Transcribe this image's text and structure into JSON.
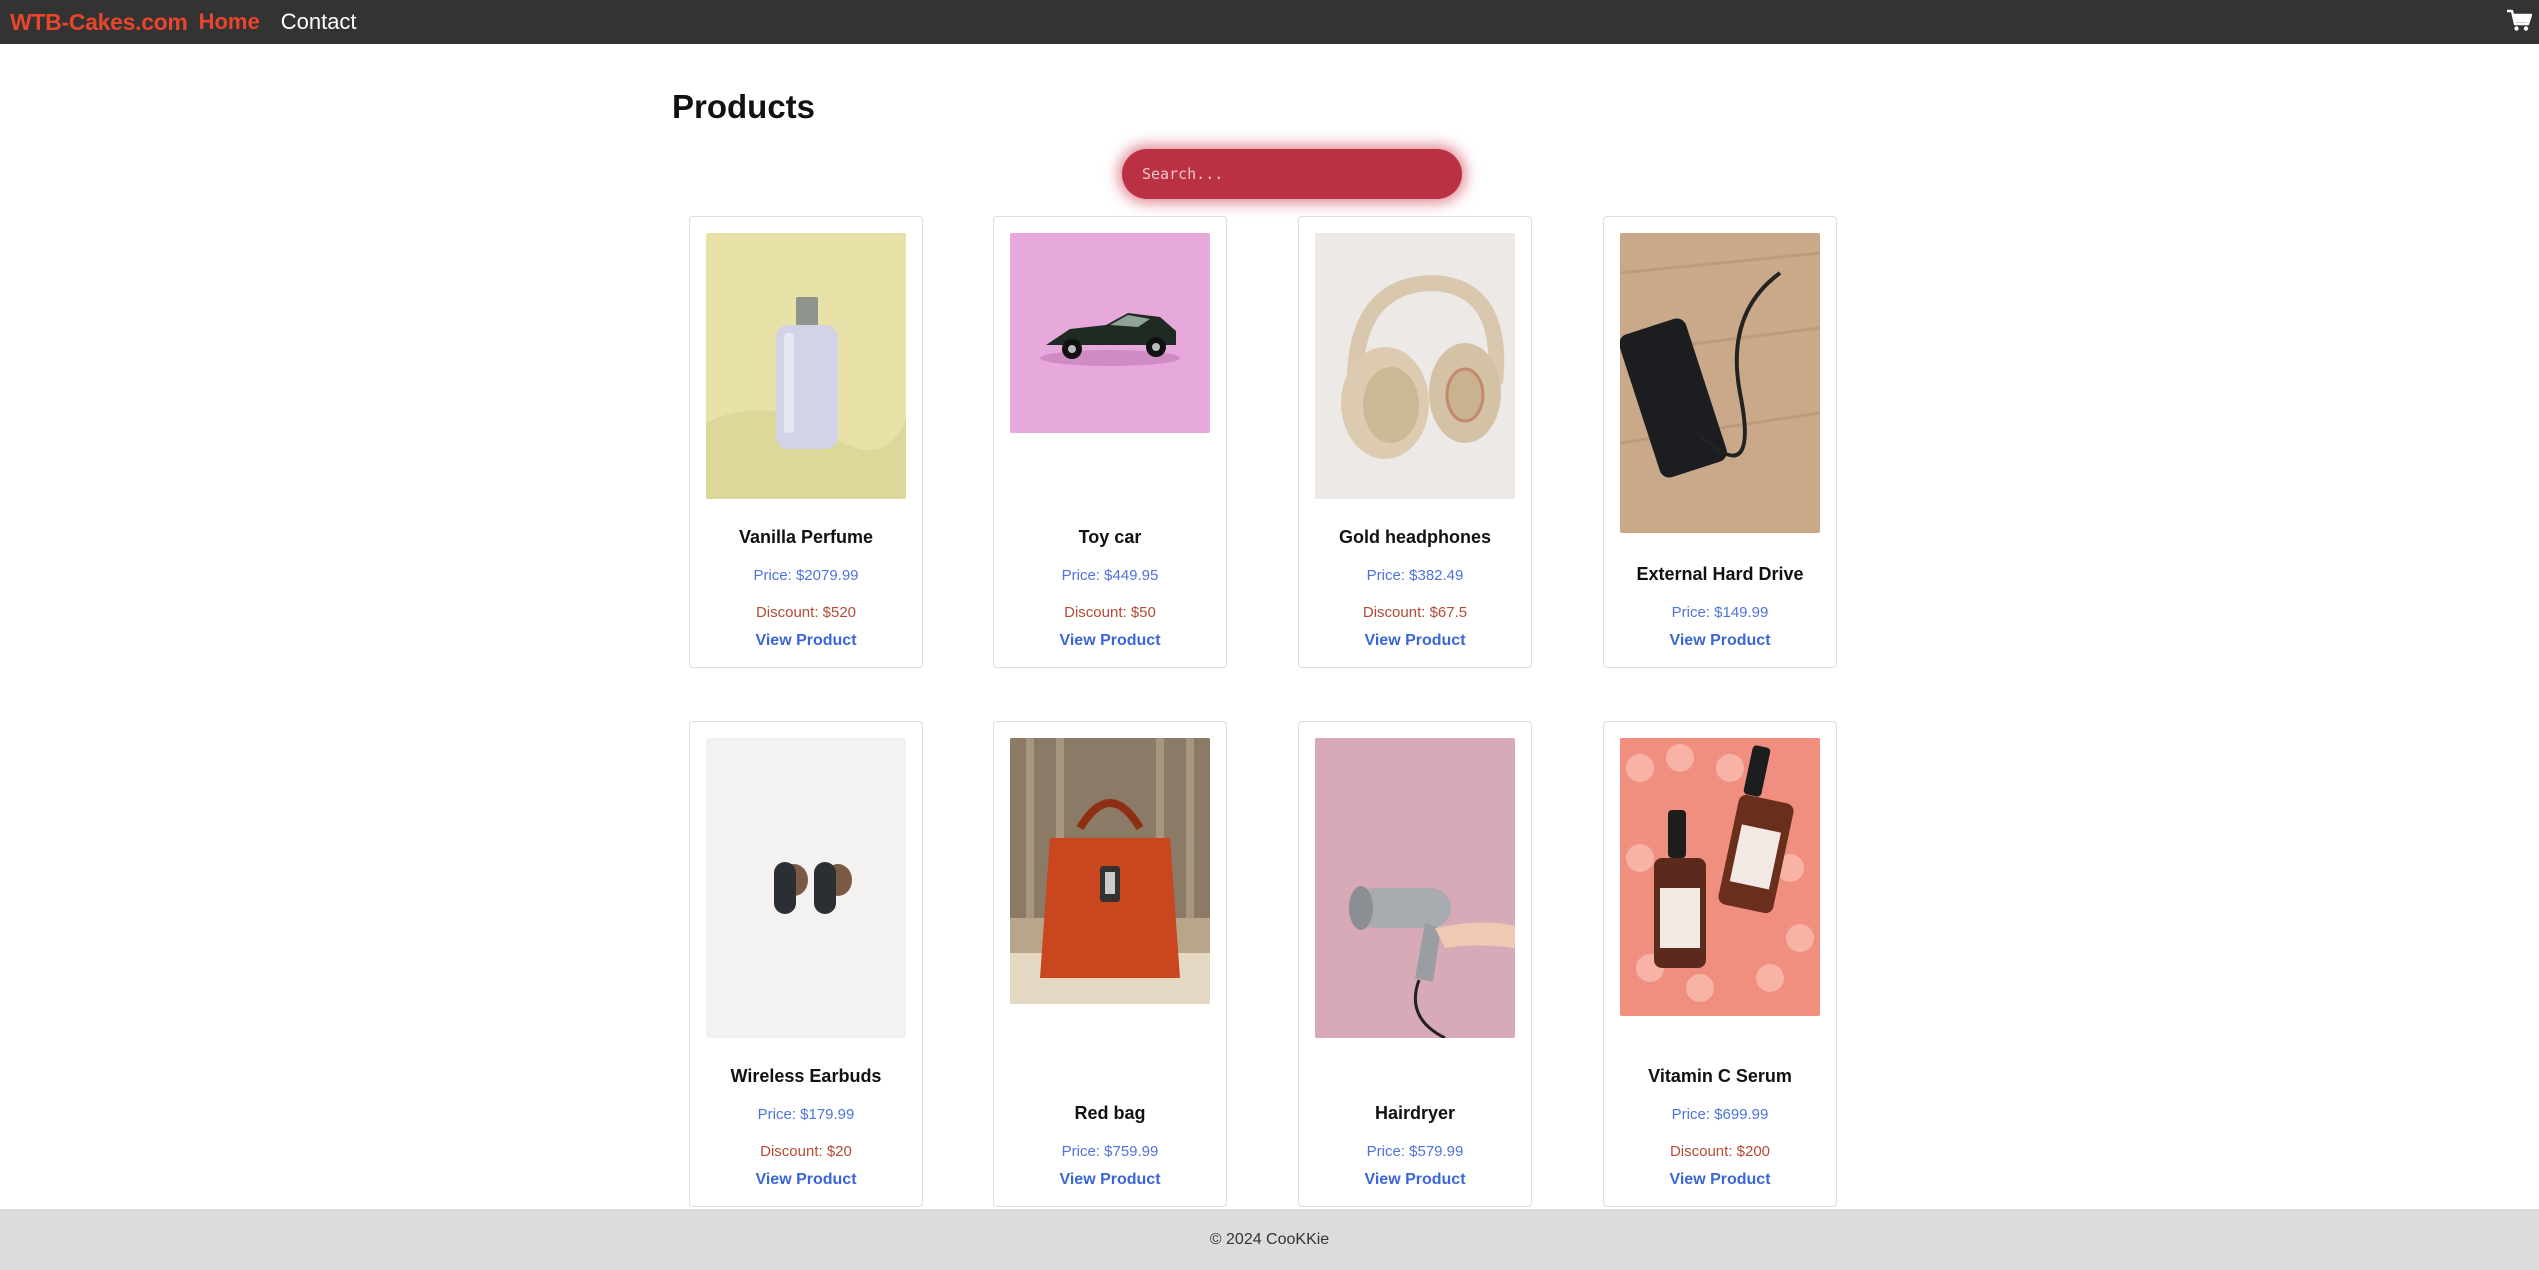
{
  "nav": {
    "brand": "WTB-Cakes.com",
    "home": "Home",
    "contact": "Contact",
    "cart_icon": "shopping-cart-icon"
  },
  "page": {
    "title": "Products",
    "search_placeholder": "Search..."
  },
  "products": [
    {
      "name": "Vanilla Perfume",
      "price": "Price: $2079.99",
      "discount": "Discount: $520",
      "view_label": "View Product",
      "image": "perfume-bottle-photo"
    },
    {
      "name": "Toy car",
      "price": "Price: $449.95",
      "discount": "Discount: $50",
      "view_label": "View Product",
      "image": "toy-car-photo"
    },
    {
      "name": "Gold headphones",
      "price": "Price: $382.49",
      "discount": "Discount: $67.5",
      "view_label": "View Product",
      "image": "headphones-photo"
    },
    {
      "name": "External Hard Drive",
      "price": "Price: $149.99",
      "view_label": "View Product",
      "image": "hard-drive-photo"
    },
    {
      "name": "Wireless Earbuds",
      "price": "Price: $179.99",
      "discount": "Discount: $20",
      "view_label": "View Product",
      "image": "earbuds-photo"
    },
    {
      "name": "Red bag",
      "price": "Price: $759.99",
      "view_label": "View Product",
      "image": "red-bag-photo"
    },
    {
      "name": "Hairdryer",
      "price": "Price: $579.99",
      "view_label": "View Product",
      "image": "hairdryer-photo"
    },
    {
      "name": "Vitamin C Serum",
      "price": "Price: $699.99",
      "discount": "Discount: $200",
      "view_label": "View Product",
      "image": "serum-bottles-photo"
    }
  ],
  "footer": {
    "text": "© 2024 CooKKie"
  }
}
